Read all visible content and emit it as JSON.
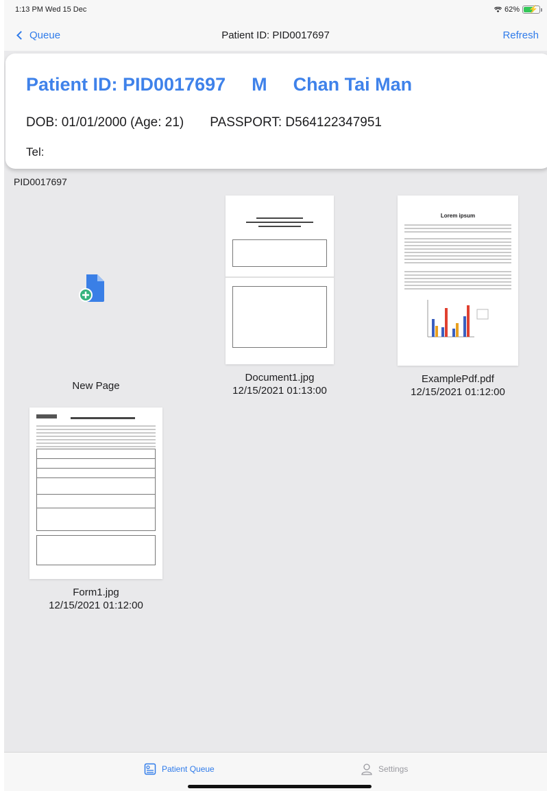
{
  "status_bar": {
    "time": "1:13 PM   Wed 15 Dec",
    "battery": "62%"
  },
  "nav": {
    "back_label": "Queue",
    "title": "Patient ID: PID0017697",
    "refresh_label": "Refresh"
  },
  "patient": {
    "id_label": "Patient ID: PID0017697",
    "sex": "M",
    "name": "Chan Tai Man",
    "dob": "DOB: 01/01/2000 (Age: 21)",
    "passport": "PASSPORT: D564122347951",
    "tel": "Tel:"
  },
  "folder_label": "PID0017697",
  "new_page_label": "New Page",
  "documents": [
    {
      "name": "Document1.jpg",
      "date": "12/15/2021 01:13:00"
    },
    {
      "name": "ExamplePdf.pdf",
      "date": "12/15/2021 01:12:00",
      "thumb_heading": "Lorem ipsum"
    },
    {
      "name": "Form1.jpg",
      "date": "12/15/2021 01:12:00"
    }
  ],
  "tabs": {
    "queue_label": "Patient Queue",
    "settings_label": "Settings"
  },
  "colors": {
    "accent": "#2f7bea",
    "title_blue": "#3f82ea",
    "background": "#e9e9eb"
  }
}
